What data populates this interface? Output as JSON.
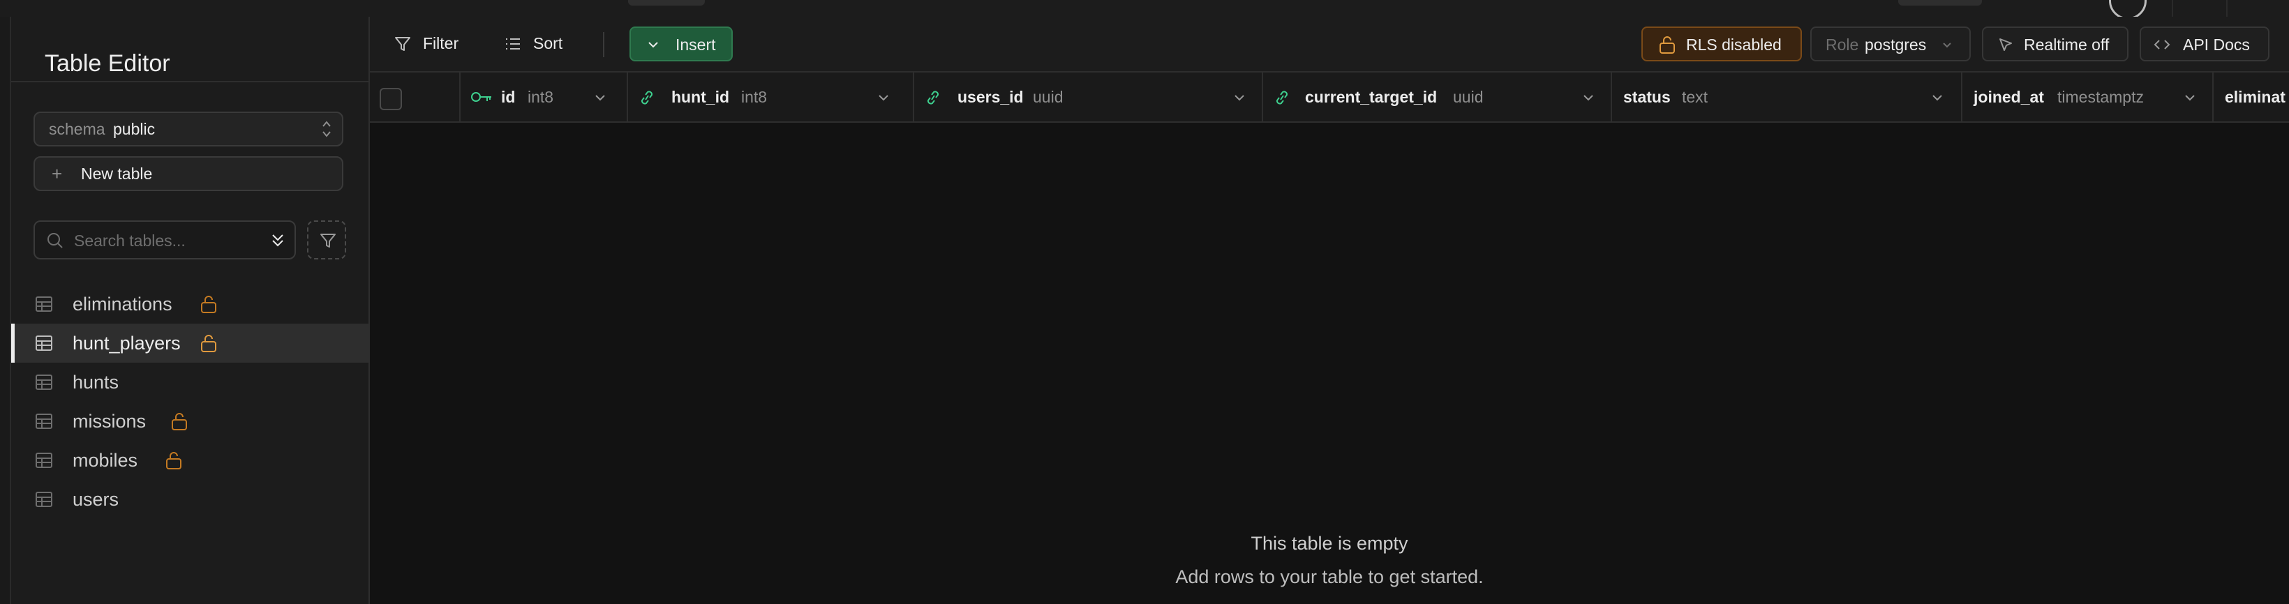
{
  "sidebar": {
    "title": "Table Editor",
    "schema_label": "schema",
    "schema_value": "public",
    "new_table_label": "New table",
    "search_placeholder": "Search tables...",
    "tables": [
      {
        "name": "eliminations",
        "rls_unlocked": true,
        "active": false
      },
      {
        "name": "hunt_players",
        "rls_unlocked": true,
        "active": true
      },
      {
        "name": "hunts",
        "rls_unlocked": false,
        "active": false
      },
      {
        "name": "missions",
        "rls_unlocked": true,
        "active": false
      },
      {
        "name": "mobiles",
        "rls_unlocked": true,
        "active": false
      },
      {
        "name": "users",
        "rls_unlocked": false,
        "active": false
      }
    ]
  },
  "toolbar": {
    "filter_label": "Filter",
    "sort_label": "Sort",
    "insert_label": "Insert",
    "rls_label": "RLS disabled",
    "role_label": "Role",
    "role_value": "postgres",
    "realtime_label": "Realtime off",
    "api_docs_label": "API Docs"
  },
  "grid": {
    "columns": [
      {
        "name": "id",
        "type": "int8",
        "icon": "key-icon"
      },
      {
        "name": "hunt_id",
        "type": "int8",
        "icon": "link-icon"
      },
      {
        "name": "users_id",
        "type": "uuid",
        "icon": "link-icon"
      },
      {
        "name": "current_target_id",
        "type": "uuid",
        "icon": "link-icon"
      },
      {
        "name": "status",
        "type": "text",
        "icon": ""
      },
      {
        "name": "joined_at",
        "type": "timestamptz",
        "icon": ""
      },
      {
        "name": "eliminat",
        "type": "",
        "icon": ""
      }
    ],
    "empty_title": "This table is empty",
    "empty_subtitle": "Add rows to your table to get started."
  },
  "colors": {
    "background": "#121212",
    "panel": "#1c1c1c",
    "brand_green": "#3ecf8e",
    "insert_bg": "#1f5c3a",
    "warning_orange": "#e09a3e"
  }
}
